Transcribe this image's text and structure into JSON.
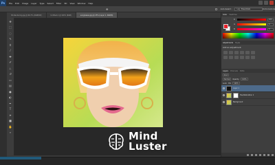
{
  "app": {
    "logo": "Ps",
    "menu": [
      "File",
      "Edit",
      "Image",
      "Layer",
      "Type",
      "Select",
      "Filter",
      "3D",
      "View",
      "Window",
      "Help"
    ]
  },
  "options_bar": {
    "auto_select_label": "Auto-Select:",
    "auto_select_value": "Layer",
    "show_transform_label": "Show Transform Controls",
    "workspace": "Essentials"
  },
  "documents": [
    {
      "label": "3D-Rendering.jpg @ 66.7% (RGB/8#)",
      "active": false
    },
    {
      "label": "Untitled-1 @ 100% (RGB)",
      "active": false
    },
    {
      "label": "sunglasses.jpg @ 25% (Layer 1, RGB/8)",
      "active": true
    }
  ],
  "tools": [
    "move-tool",
    "marquee-tool",
    "lasso-tool",
    "quick-select-tool",
    "crop-tool",
    "eyedropper-tool",
    "healing-tool",
    "brush-tool",
    "clone-tool",
    "history-brush-tool",
    "eraser-tool",
    "gradient-tool",
    "blur-tool",
    "dodge-tool",
    "pen-tool",
    "type-tool",
    "path-select-tool",
    "shape-tool",
    "hand-tool",
    "zoom-tool"
  ],
  "color_panel": {
    "tabs": [
      "Color",
      "Swatches"
    ],
    "channels": [
      {
        "letter": "R",
        "value": "255",
        "gradient_color": "#ff0000"
      },
      {
        "letter": "G",
        "value": "0",
        "gradient_color": "#00ff00"
      },
      {
        "letter": "B",
        "value": "0",
        "gradient_color": "#0000ff"
      }
    ],
    "foreground": "#e8202a",
    "background": "#ffffff"
  },
  "adjustments_panel": {
    "tabs": [
      "Adjustments",
      "Styles"
    ],
    "title": "Add an adjustment",
    "icon_count": 12
  },
  "layers_panel": {
    "tabs": [
      "Layers",
      "Channels",
      "Paths"
    ],
    "kind_label": "Kind",
    "blend_mode": "Normal",
    "opacity_label": "Opacity:",
    "opacity_value": "100%",
    "lock_label": "Lock:",
    "fill_label": "Fill:",
    "fill_value": "100%",
    "layers": [
      {
        "name": "Layer 1",
        "thumb": "black",
        "active": true
      },
      {
        "name": "Hue/Saturation 1",
        "thumb": "mask",
        "active": false
      },
      {
        "name": "Background",
        "thumb": "photo",
        "active": false
      }
    ]
  },
  "brand": {
    "line1": "Mind",
    "line2": "Luster"
  },
  "colors": {
    "accent": "#1e90d0",
    "selection": "#4d6a8a"
  }
}
